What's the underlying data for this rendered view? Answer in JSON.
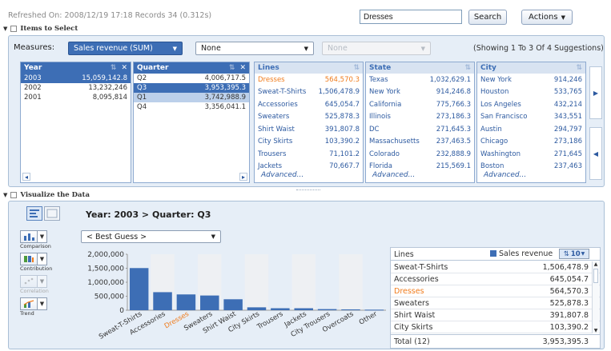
{
  "header": {
    "refreshed": "Refreshed On: 2008/12/19 17:18   Records 34 (0.312s)",
    "search_value": "Dresses",
    "search_button": "Search",
    "actions_button": "Actions"
  },
  "items_section": {
    "title": "Items to Select",
    "measures_label": "Measures:",
    "measure1": "Sales revenue (SUM)",
    "measure2": "None",
    "measure3": "None",
    "showing": "(Showing 1 To 3 Of 4 Suggestions)",
    "year": {
      "header": "Year",
      "rows": [
        {
          "label": "2003",
          "value": "15,059,142.8",
          "state": "selected"
        },
        {
          "label": "2002",
          "value": "13,232,246",
          "state": ""
        },
        {
          "label": "2001",
          "value": "8,095,814",
          "state": ""
        }
      ]
    },
    "quarter": {
      "header": "Quarter",
      "rows": [
        {
          "label": "Q2",
          "value": "4,006,717.5",
          "state": ""
        },
        {
          "label": "Q3",
          "value": "3,953,395.3",
          "state": "selected"
        },
        {
          "label": "Q1",
          "value": "3,742,988.9",
          "state": "light"
        },
        {
          "label": "Q4",
          "value": "3,356,041.1",
          "state": ""
        }
      ]
    },
    "lines": {
      "header": "Lines",
      "rows": [
        {
          "label": "Dresses",
          "value": "564,570.3",
          "state": "orange"
        },
        {
          "label": "Sweat-T-Shirts",
          "value": "1,506,478.9",
          "state": ""
        },
        {
          "label": "Accessories",
          "value": "645,054.7",
          "state": ""
        },
        {
          "label": "Sweaters",
          "value": "525,878.3",
          "state": ""
        },
        {
          "label": "Shirt Waist",
          "value": "391,807.8",
          "state": ""
        },
        {
          "label": "City Skirts",
          "value": "103,390.2",
          "state": ""
        },
        {
          "label": "Trousers",
          "value": "71,101.2",
          "state": ""
        },
        {
          "label": "Jackets",
          "value": "70,667.7",
          "state": ""
        }
      ]
    },
    "state": {
      "header": "State",
      "rows": [
        {
          "label": "Texas",
          "value": "1,032,629.1",
          "state": ""
        },
        {
          "label": "New York",
          "value": "914,246.8",
          "state": ""
        },
        {
          "label": "California",
          "value": "775,766.3",
          "state": ""
        },
        {
          "label": "Illinois",
          "value": "273,186.3",
          "state": ""
        },
        {
          "label": "DC",
          "value": "271,645.3",
          "state": ""
        },
        {
          "label": "Massachusetts",
          "value": "237,463.5",
          "state": ""
        },
        {
          "label": "Colorado",
          "value": "232,888.9",
          "state": ""
        },
        {
          "label": "Florida",
          "value": "215,569.1",
          "state": ""
        }
      ]
    },
    "city": {
      "header": "City",
      "rows": [
        {
          "label": "New York",
          "value": "914,246",
          "state": ""
        },
        {
          "label": "Houston",
          "value": "533,765",
          "state": ""
        },
        {
          "label": "Los Angeles",
          "value": "432,214",
          "state": ""
        },
        {
          "label": "San Francisco",
          "value": "343,551",
          "state": ""
        },
        {
          "label": "Austin",
          "value": "294,797",
          "state": ""
        },
        {
          "label": "Chicago",
          "value": "273,186",
          "state": ""
        },
        {
          "label": "Washington",
          "value": "271,645",
          "state": ""
        },
        {
          "label": "Boston",
          "value": "237,463",
          "state": ""
        }
      ]
    },
    "advanced": "Advanced..."
  },
  "visualize": {
    "title": "Visualize the Data",
    "breadcrumb": "Year: 2003 > Quarter: Q3",
    "chart_type_select": "< Best Guess >",
    "side_labels": [
      "Comparison",
      "Contribution",
      "Correlation",
      "Trend"
    ],
    "table": {
      "col1": "Lines",
      "col2": "Sales revenue",
      "sort_count": "10",
      "rows": [
        {
          "label": "Sweat-T-Shirts",
          "value": "1,506,478.9",
          "highlight": false
        },
        {
          "label": "Accessories",
          "value": "645,054.7",
          "highlight": false
        },
        {
          "label": "Dresses",
          "value": "564,570.3",
          "highlight": true
        },
        {
          "label": "Sweaters",
          "value": "525,878.3",
          "highlight": false
        },
        {
          "label": "Shirt Waist",
          "value": "391,807.8",
          "highlight": false
        },
        {
          "label": "City Skirts",
          "value": "103,390.2",
          "highlight": false
        }
      ],
      "total_label": "Total (12)",
      "total_value": "3,953,395.3"
    }
  },
  "colors": {
    "accent": "#3d6eb5",
    "bar": "#3d6eb5",
    "highlight": "#f07c1d",
    "panel_bg": "#e6eef7"
  },
  "chart_data": {
    "type": "bar",
    "categories": [
      "Sweat-T-Shirts",
      "Accessories",
      "Dresses",
      "Sweaters",
      "Shirt Waist",
      "City Skirts",
      "Trousers",
      "Jackets",
      "City Trousers",
      "Overcoats",
      "Other"
    ],
    "values": [
      1506478.9,
      645054.7,
      564570.3,
      525878.3,
      391807.8,
      103390.2,
      71101.2,
      70667.7,
      40000,
      30000,
      20000
    ],
    "highlight_category": "Dresses",
    "ylim": [
      0,
      2000000
    ],
    "yticks": [
      "2,000,000",
      "1,500,000",
      "1,000,000",
      "500,000",
      "0"
    ],
    "ytick_values": [
      2000000,
      1500000,
      1000000,
      500000,
      0
    ],
    "title": "",
    "xlabel": "",
    "ylabel": ""
  }
}
